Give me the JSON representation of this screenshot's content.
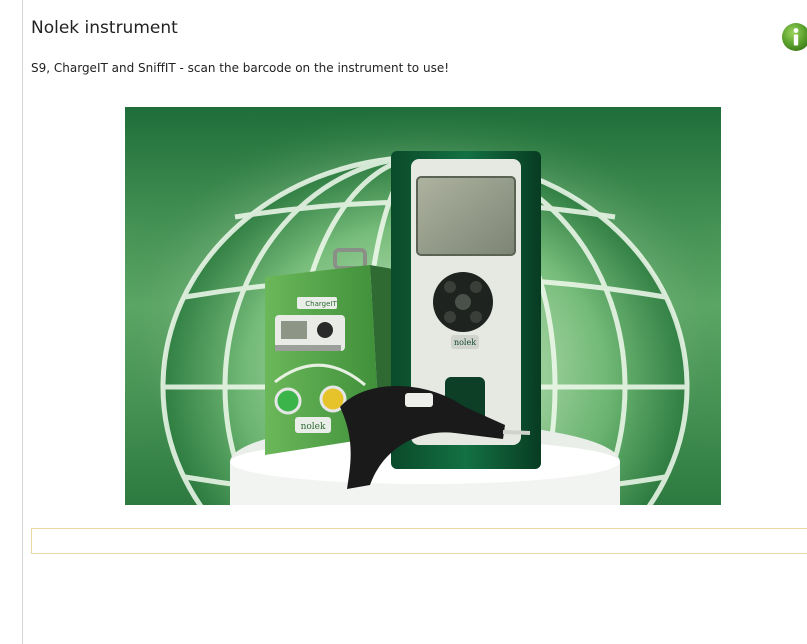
{
  "header": {
    "title": "Nolek instrument",
    "subtitle": "S9, ChargeIT and SniffIT - scan the barcode on the instrument to use!",
    "info_icon": "info-icon"
  },
  "image": {
    "description_icon": "instrument-photo",
    "chargeit_label": "ChargeIT",
    "brand_label": "nolek",
    "colors": {
      "background_green": "#3f8f4f",
      "device_green": "#0f5a35",
      "chargeit_green": "#5ea84a"
    }
  },
  "barcode": {
    "value": "",
    "placeholder": ""
  },
  "colors": {
    "info_icon": "#5aa02c",
    "input_border": "#e8d9a6"
  }
}
